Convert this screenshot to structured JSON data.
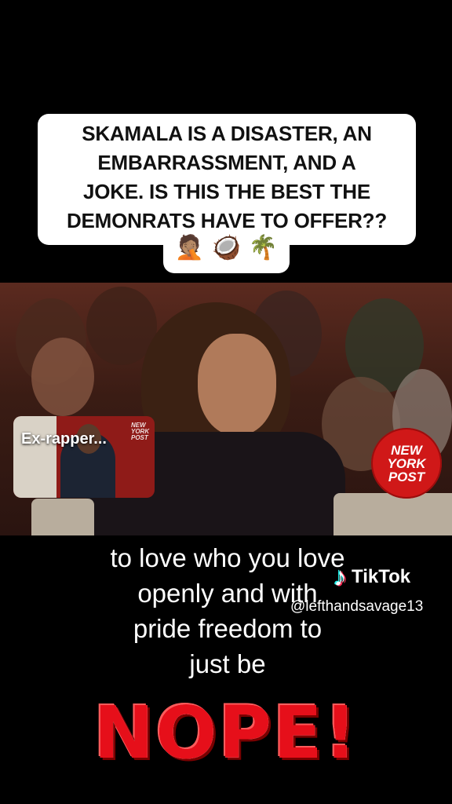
{
  "caption": {
    "lines": [
      "SKAMALA IS A DISASTER, AN",
      "EMBARRASSMENT, AND A",
      "JOKE. IS THIS THE BEST THE",
      "DEMONRATS HAVE TO OFFER??"
    ],
    "emoji": "🤦🏽 🥥 🌴"
  },
  "inset": {
    "label": "Ex-rapper...",
    "logo": "NEW YORK POST"
  },
  "badge": {
    "line1": "NEW",
    "line2": "YORK",
    "line3": "POST",
    "color": "#d01818"
  },
  "subtitle": {
    "lines": [
      "to love who you love",
      "openly and with",
      "pride freedom to",
      "just be"
    ]
  },
  "watermark": {
    "icon": "tiktok-note-icon",
    "brand": "TikTok",
    "handle": "@lefthandsavage13"
  },
  "nope": {
    "text": "NOPE!",
    "color": "#e60f1a"
  }
}
